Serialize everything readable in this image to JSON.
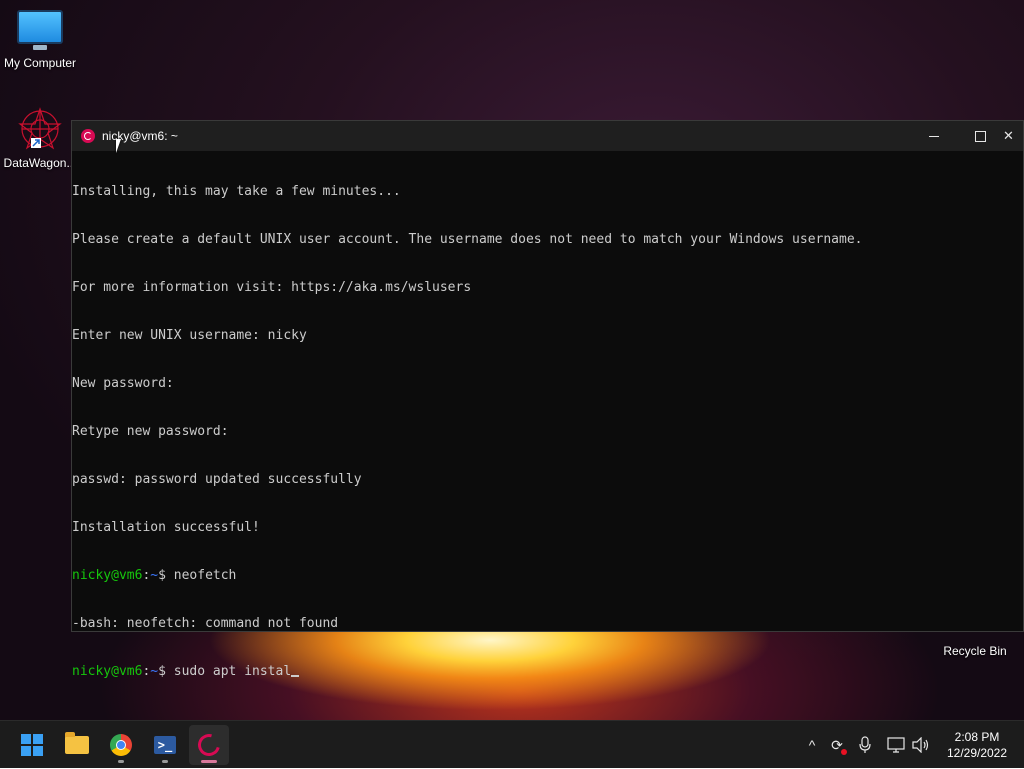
{
  "desktop": {
    "icons": [
      {
        "label": "My Computer",
        "icon": "monitor-icon"
      },
      {
        "label": "DataWagon...",
        "icon": "datawagon-shortcut-icon"
      },
      {
        "label": "Recycle Bin",
        "icon": "recycle-bin-icon"
      }
    ]
  },
  "terminal": {
    "title": "nicky@vm6: ~",
    "controls": {
      "minimize": "minimize-icon",
      "maximize": "maximize-icon",
      "close": "close-icon"
    },
    "lines": [
      "Installing, this may take a few minutes...",
      "Please create a default UNIX user account. The username does not need to match your Windows username.",
      "For more information visit: https://aka.ms/wslusers",
      "Enter new UNIX username: nicky",
      "New password:",
      "Retype new password:",
      "passwd: password updated successfully",
      "Installation successful!"
    ],
    "prompts": [
      {
        "user": "nicky@vm6",
        "sep": ":",
        "path": "~",
        "symbol": "$ ",
        "command": "neofetch"
      },
      {
        "output": "-bash: neofetch: command not found"
      },
      {
        "user": "nicky@vm6",
        "sep": ":",
        "path": "~",
        "symbol": "$ ",
        "command": "sudo apt instal"
      }
    ],
    "colors": {
      "background": "#0c0c0c",
      "text": "#cccccc",
      "user": "#16c60c",
      "path": "#3b78ff"
    }
  },
  "taskbar": {
    "apps": [
      {
        "name": "Start",
        "icon": "windows-start-icon"
      },
      {
        "name": "File Explorer",
        "icon": "folder-icon"
      },
      {
        "name": "Google Chrome",
        "icon": "chrome-icon"
      },
      {
        "name": "PowerShell",
        "icon": "powershell-icon"
      },
      {
        "name": "Debian",
        "icon": "debian-icon",
        "active": true
      }
    ],
    "tray": {
      "chevron": "^",
      "clock_time": "2:08 PM",
      "clock_date": "12/29/2022"
    }
  }
}
